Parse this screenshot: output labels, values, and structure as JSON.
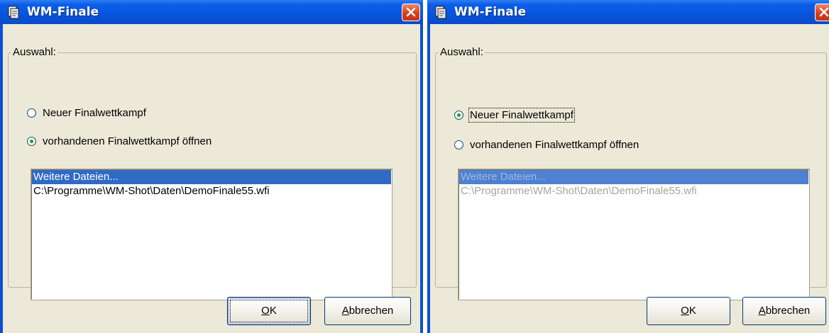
{
  "windows": [
    {
      "title": "WM-Finale",
      "group_label": "Auswahl:",
      "radio_new": {
        "label": "Neuer Finalwettkampf",
        "checked": false
      },
      "radio_open": {
        "label": "vorhandenen Finalwettkampf öffnen",
        "checked": true
      },
      "list_items": [
        "Weitere Dateien...",
        "C:\\Programme\\WM-Shot\\Daten\\DemoFinale55.wfi"
      ],
      "list_enabled": true,
      "ok_accel": "O",
      "ok_rest": "K",
      "cancel_accel": "A",
      "cancel_rest": "bbrechen"
    },
    {
      "title": "WM-Finale",
      "group_label": "Auswahl:",
      "radio_new": {
        "label": "Neuer Finalwettkampf",
        "checked": true
      },
      "radio_open": {
        "label": "vorhandenen Finalwettkampf öffnen",
        "checked": false
      },
      "list_items": [
        "Weitere Dateien...",
        "C:\\Programme\\WM-Shot\\Daten\\DemoFinale55.wfi"
      ],
      "list_enabled": false,
      "ok_accel": "O",
      "ok_rest": "K",
      "cancel_accel": "A",
      "cancel_rest": "bbrechen"
    }
  ],
  "icons": {
    "app": "document-window-icon",
    "close": "close-icon"
  },
  "colors": {
    "titlebar": "#0755dd",
    "client": "#ece9d8",
    "selection": "#316ac5",
    "close": "#d5401e"
  }
}
